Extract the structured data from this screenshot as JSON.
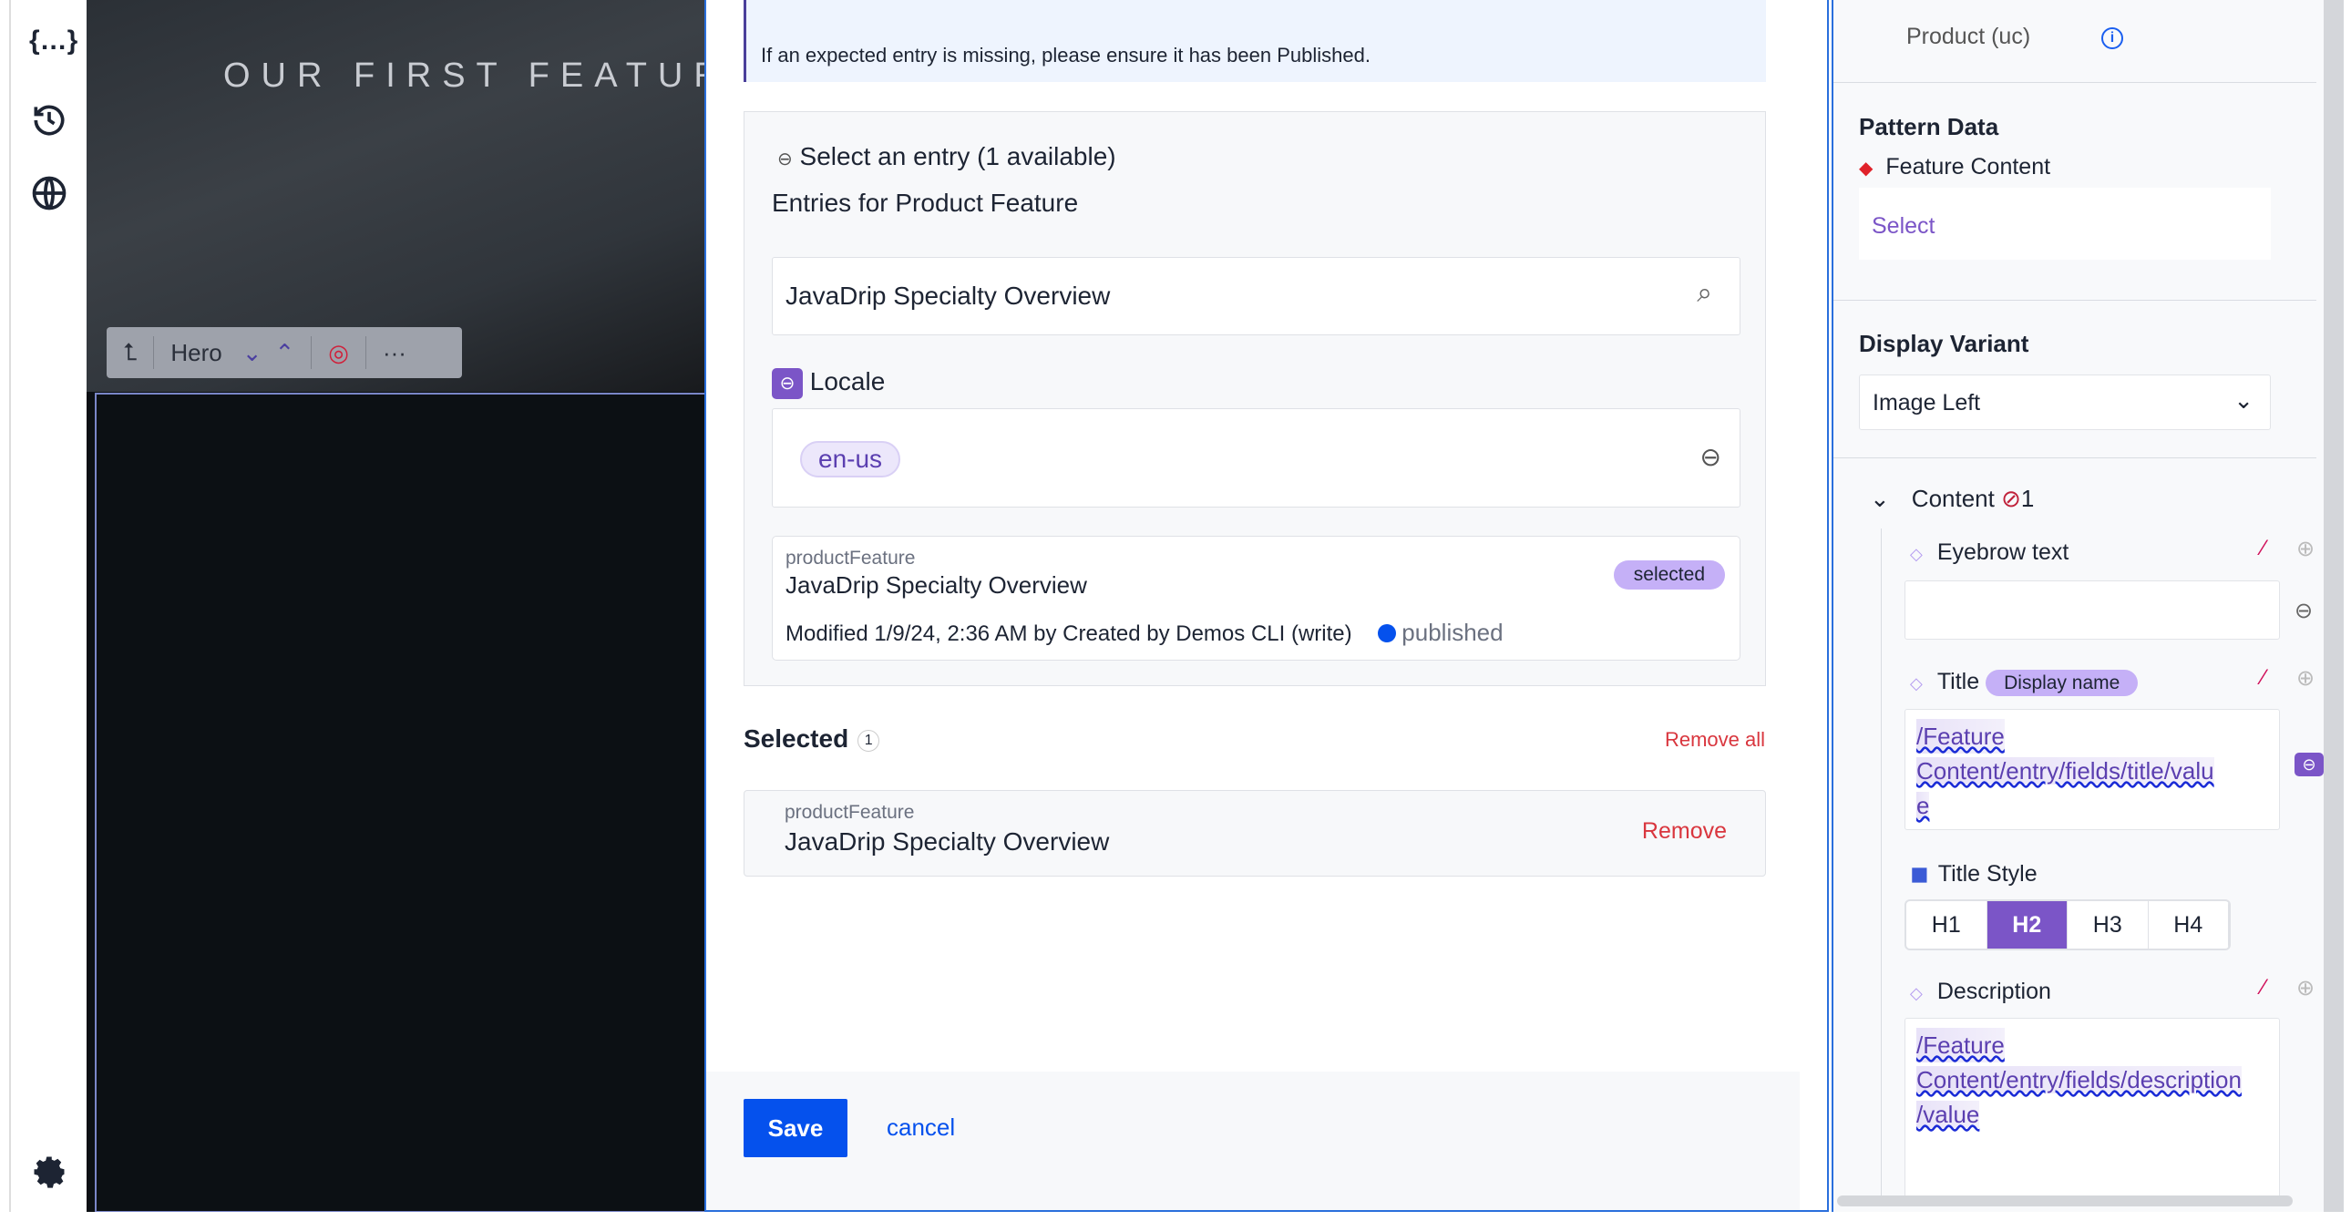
{
  "rail": {
    "icons": [
      "braces-icon",
      "history-icon",
      "globe-icon",
      "gear-icon"
    ]
  },
  "canvas": {
    "hero_title": "OUR FIRST FEATURE",
    "toolbar": {
      "component": "Hero",
      "icons": [
        "arrow-up-left-icon",
        "chevron-down-icon",
        "chevron-up-icon",
        "target-icon",
        "more-icon"
      ]
    }
  },
  "modal": {
    "banner": "If an expected entry is missing, please ensure it has been Published.",
    "select_title": "Select an entry (1 available)",
    "entries_for": "Entries for Product Feature",
    "search_value": "JavaDrip Specialty Overview",
    "locale_label": "Locale",
    "locale_value": "en-us",
    "entry": {
      "type": "productFeature",
      "title": "JavaDrip Specialty Overview",
      "badge": "selected",
      "meta": "Modified 1/9/24, 2:36 AM by Created by Demos CLI (write)",
      "status": "published"
    },
    "selected_label": "Selected",
    "selected_count": "1",
    "remove_all": "Remove all",
    "selected_item": {
      "type": "productFeature",
      "title": "JavaDrip Specialty Overview",
      "remove": "Remove"
    },
    "save": "Save",
    "cancel": "cancel"
  },
  "right": {
    "top_text": "Product (uc)",
    "pattern_data": "Pattern Data",
    "feature_content": "Feature Content",
    "select": "Select",
    "display_variant": "Display Variant",
    "variant_value": "Image Left",
    "content": "Content",
    "content_count": "1",
    "eyebrow": "Eyebrow text",
    "eyebrow_value": "",
    "title": "Title",
    "title_badge": "Display name",
    "title_value": {
      "a": "/Feature",
      "b": "Content/entry/fields/title/valu",
      "c": "e"
    },
    "title_style": "Title Style",
    "headings": [
      "H1",
      "H2",
      "H3",
      "H4"
    ],
    "heading_selected": "H2",
    "description": "Description",
    "desc_value": {
      "a": "/Feature",
      "b": "Content/entry/fields/description",
      "c": "/value"
    }
  },
  "colors": {
    "accent": "#7b55c7",
    "primary": "#0551ed",
    "danger": "#d9363e",
    "published": "#0551ed"
  }
}
